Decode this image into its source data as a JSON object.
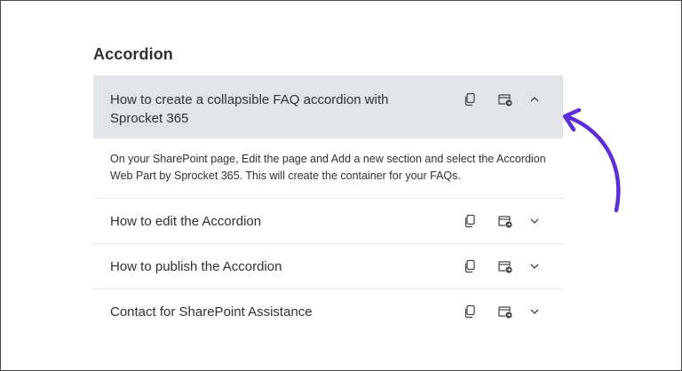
{
  "heading": "Accordion",
  "items": [
    {
      "title": "How to create a collapsible FAQ accordion with Sprocket 365",
      "expanded": true,
      "content": "On your SharePoint page, Edit the page and Add a new section and select the Accordion Web Part by Sprocket 365. This will create the container for your FAQs."
    },
    {
      "title": "How to edit the Accordion",
      "expanded": false
    },
    {
      "title": "How to publish the Accordion",
      "expanded": false
    },
    {
      "title": "Contact for SharePoint Assistance",
      "expanded": false
    }
  ],
  "icons": {
    "copy": "copy-icon",
    "share": "share-link-icon",
    "expand": "chevron-down-icon",
    "collapse": "chevron-up-icon",
    "annotation": "arrow-annotation-icon"
  },
  "colors": {
    "expanded_header_bg": "#e1e4e8",
    "arrow": "#5b2ed6",
    "text": "#323130"
  }
}
